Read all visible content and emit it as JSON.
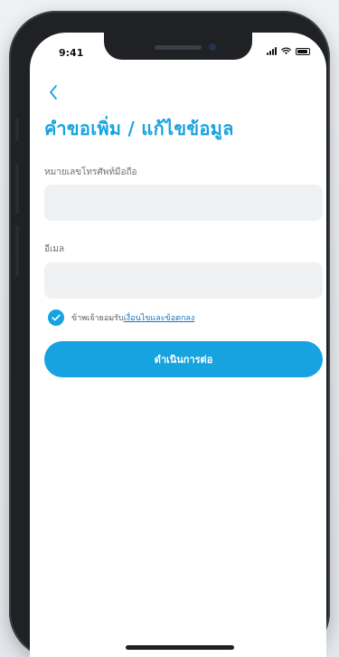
{
  "status_bar": {
    "time": "9:41"
  },
  "header": {
    "back_icon": "chevron-left-icon",
    "title": "คำขอเพิ่ม / แก้ไขข้อมูล"
  },
  "form": {
    "phone": {
      "label": "หมายเลขโทรศัพท์มือถือ",
      "value": "",
      "placeholder": ""
    },
    "email": {
      "label": "อีเมล",
      "value": "",
      "placeholder": ""
    },
    "consent": {
      "checked": true,
      "text": "ข้าพเจ้ายอมรับ",
      "link_text": "เงื่อนไขและข้อตกลง"
    },
    "submit_label": "ดำเนินการต่อ"
  },
  "colors": {
    "accent": "#17a3e0",
    "link": "#1576c4",
    "input_bg": "#f0f1f3"
  }
}
